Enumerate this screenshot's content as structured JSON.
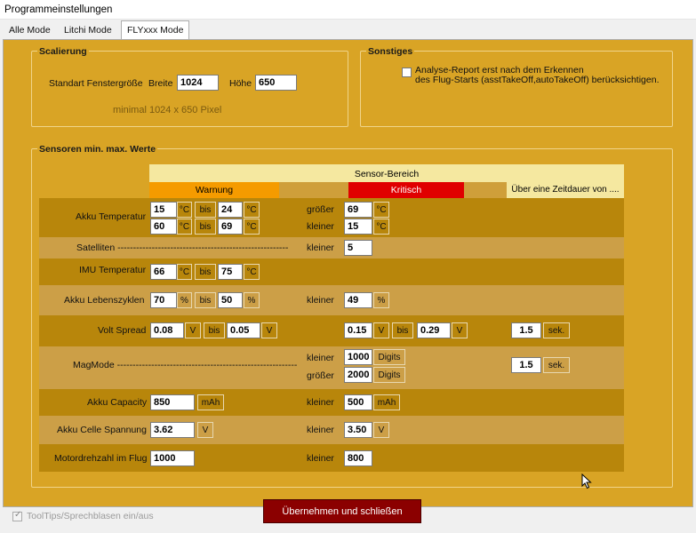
{
  "window": {
    "title": "Programmeinstellungen"
  },
  "tabs": [
    "Alle Mode",
    "Litchi Mode",
    "FLYxxx Mode"
  ],
  "scalierung": {
    "title": "Scalierung",
    "label": "Standart Fenstergröße",
    "breite_label": "Breite",
    "breite": "1024",
    "hoehe_label": "Höhe",
    "hoehe": "650",
    "min_text": "minimal 1024 x 650 Pixel"
  },
  "sonstiges": {
    "title": "Sonstiges",
    "line1": "Analyse-Report erst nach dem Erkennen",
    "line2": "des Flug-Starts (asstTakeOff,autoTakeOff) berücksichtigen."
  },
  "sensoren": {
    "title": "Sensoren min. max. Werte",
    "bereich": "Sensor-Bereich",
    "warnung": "Warnung",
    "kritisch": "Kritisch",
    "zeitdauer": "Über eine Zeitdauer von ....",
    "labels": {
      "akku_temp": "Akku Temperatur",
      "satelliten": "Satelliten -------------------------------------------------------",
      "imu": "IMU Temperatur",
      "zyklen": "Akku Lebenszyklen",
      "volt": "Volt Spread",
      "mag": "MagMode ----------------------------------------------------------",
      "capacity": "Akku Capacity",
      "zelle": "Akku Celle Spannung",
      "motor": "Motordrehzahl im Flug"
    },
    "words": {
      "bis": "bis",
      "groesser": "größer",
      "kleiner": "kleiner"
    },
    "units": {
      "c": "°C",
      "pct": "%",
      "v": "V",
      "mah": "mAh",
      "digits": "Digits",
      "sek": "sek."
    },
    "values": {
      "at_w1": "15",
      "at_w2": "24",
      "at_w3": "60",
      "at_w4": "69",
      "at_k1": "69",
      "at_k2": "15",
      "sat_k": "5",
      "imu1": "66",
      "imu2": "75",
      "zy1": "70",
      "zy2": "50",
      "zy_k": "49",
      "vs1": "0.08",
      "vs2": "0.05",
      "vs_k1": "0.15",
      "vs_k2": "0.29",
      "vs_t": "1.5",
      "mag1": "1000",
      "mag2": "2000",
      "mag_t": "1.5",
      "cap": "850",
      "cap_k": "500",
      "cell": "3.62",
      "cell_k": "3.50",
      "mot": "1000",
      "mot_k": "800"
    }
  },
  "tooltips_label": "ToolTips/Sprechblasen ein/aus",
  "apply_button": "Übernehmen und schließen",
  "colors": {
    "panel": "#d9a425",
    "warn": "#f59b00",
    "crit": "#e00000",
    "header": "#f5e8a0",
    "button": "#8b0000"
  }
}
